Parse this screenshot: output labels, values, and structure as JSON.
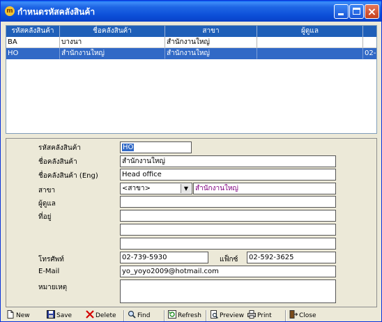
{
  "window": {
    "title": "กำหนดรหัสคลังสินค้า",
    "icon": "app-logo-icon"
  },
  "grid": {
    "columns": [
      "รหัสคลังสินค้า",
      "ชื่อคลังสินค้า",
      "สาขา",
      "ผู้ดูแล",
      ""
    ],
    "rows": [
      [
        "BA",
        "บางนา",
        "สำนักงานใหญ่",
        "",
        ""
      ],
      [
        "HO",
        "สำนักงานใหญ่",
        "สำนักงานใหญ่",
        "",
        "02-"
      ]
    ],
    "selected_row": 1
  },
  "form": {
    "code_label": "รหัสคลังสินค้า",
    "code_value": "HO",
    "name_label": "ชื่อคลังสินค้า",
    "name_value": "สำนักงานใหญ่",
    "name_eng_label": "ชื่อคลังสินค้า (Eng)",
    "name_eng_value": "Head office",
    "branch_label": "สาขา",
    "branch_select": "<สาขา>",
    "branch_name": "สำนักงานใหญ่",
    "keeper_label": "ผู้ดูแล",
    "keeper_value": "",
    "address_label": "ที่อยู่",
    "address_lines": [
      "",
      "",
      "",
      ""
    ],
    "phone_label": "โทรศัพท์",
    "phone_value": "02-739-5930",
    "fax_label": "แฟ็กซ์",
    "fax_value": "02-592-3625",
    "email_label": "E-Mail",
    "email_value": "yo_yoyo2009@hotmail.com",
    "note_label": "หมายเหตุ",
    "note_value": ""
  },
  "toolbar": {
    "new": "New",
    "save": "Save",
    "delete": "Delete",
    "find": "Find",
    "refresh": "Refresh",
    "preview": "Preview",
    "print": "Print",
    "close": "Close"
  },
  "colors": {
    "title_bar": "#0c4fd8",
    "grid_header": "#1f5fb8",
    "selection": "#3169c6",
    "window_bg": "#ece9d8"
  }
}
